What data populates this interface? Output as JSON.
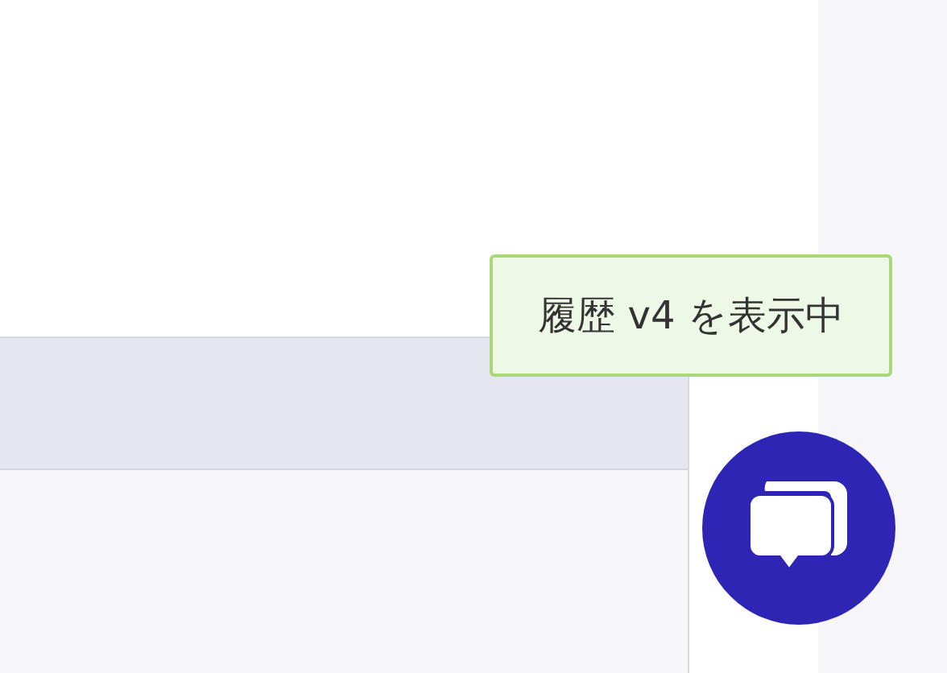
{
  "tooltip": {
    "text": "履歴 v4 を表示中"
  }
}
